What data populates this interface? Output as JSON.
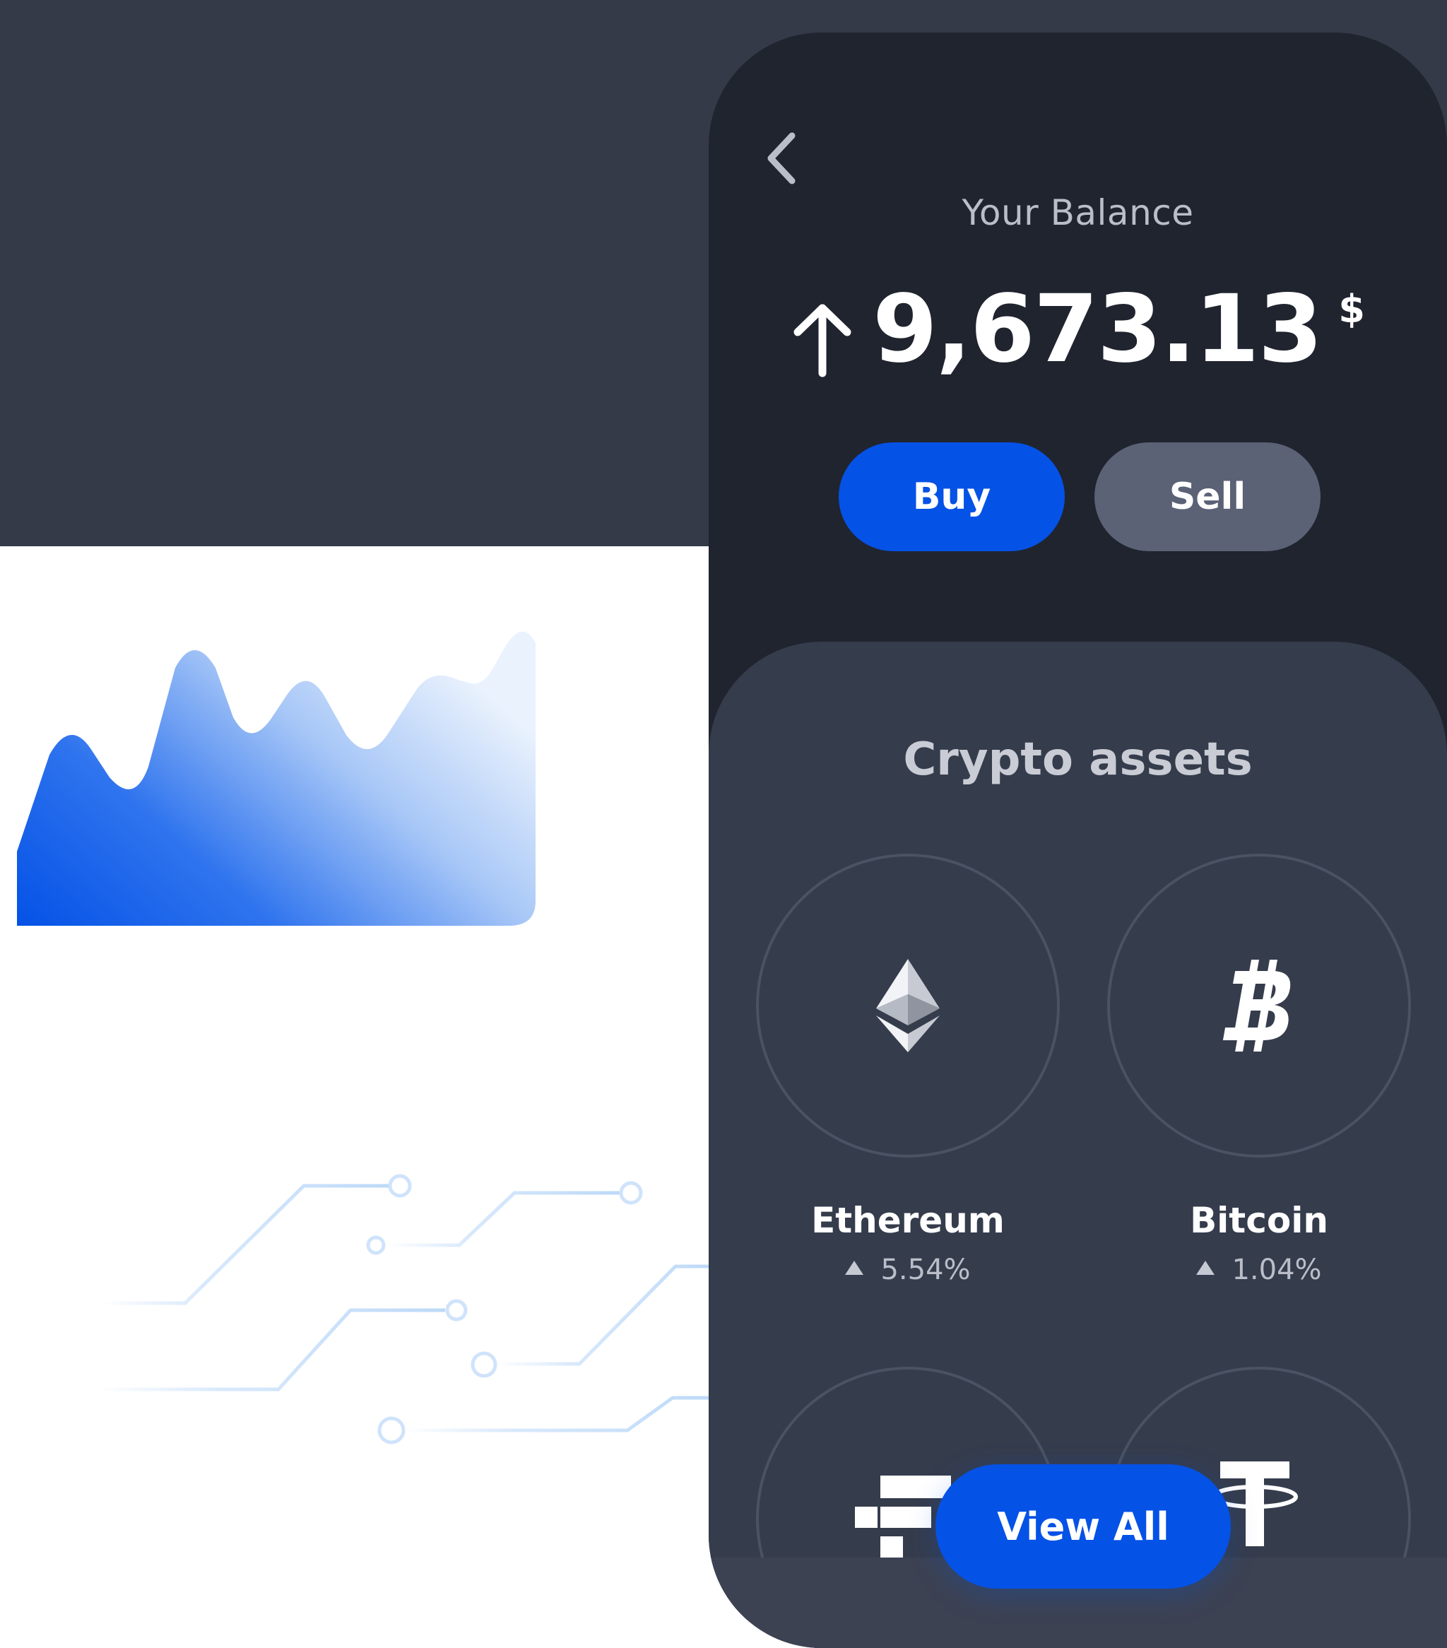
{
  "balance": {
    "label": "Your Balance",
    "value": "9,673.13",
    "currency": "$"
  },
  "actions": {
    "buy_label": "Buy",
    "sell_label": "Sell"
  },
  "assets": {
    "title": "Crypto assets",
    "items": [
      {
        "name": "Ethereum",
        "change": "5.54%",
        "icon": "ethereum-icon"
      },
      {
        "name": "Bitcoin",
        "change": "1.04%",
        "icon": "bitcoin-icon"
      },
      {
        "name": "",
        "change": "",
        "icon": "ftx-icon"
      },
      {
        "name": "",
        "change": "",
        "icon": "tether-icon"
      }
    ],
    "view_all_label": "View All"
  },
  "colors": {
    "accent": "#0552e6",
    "sell": "#5b6276",
    "phone_bg": "#20242f",
    "panel_bg": "#353c4c",
    "page_dark": "#343a48"
  }
}
